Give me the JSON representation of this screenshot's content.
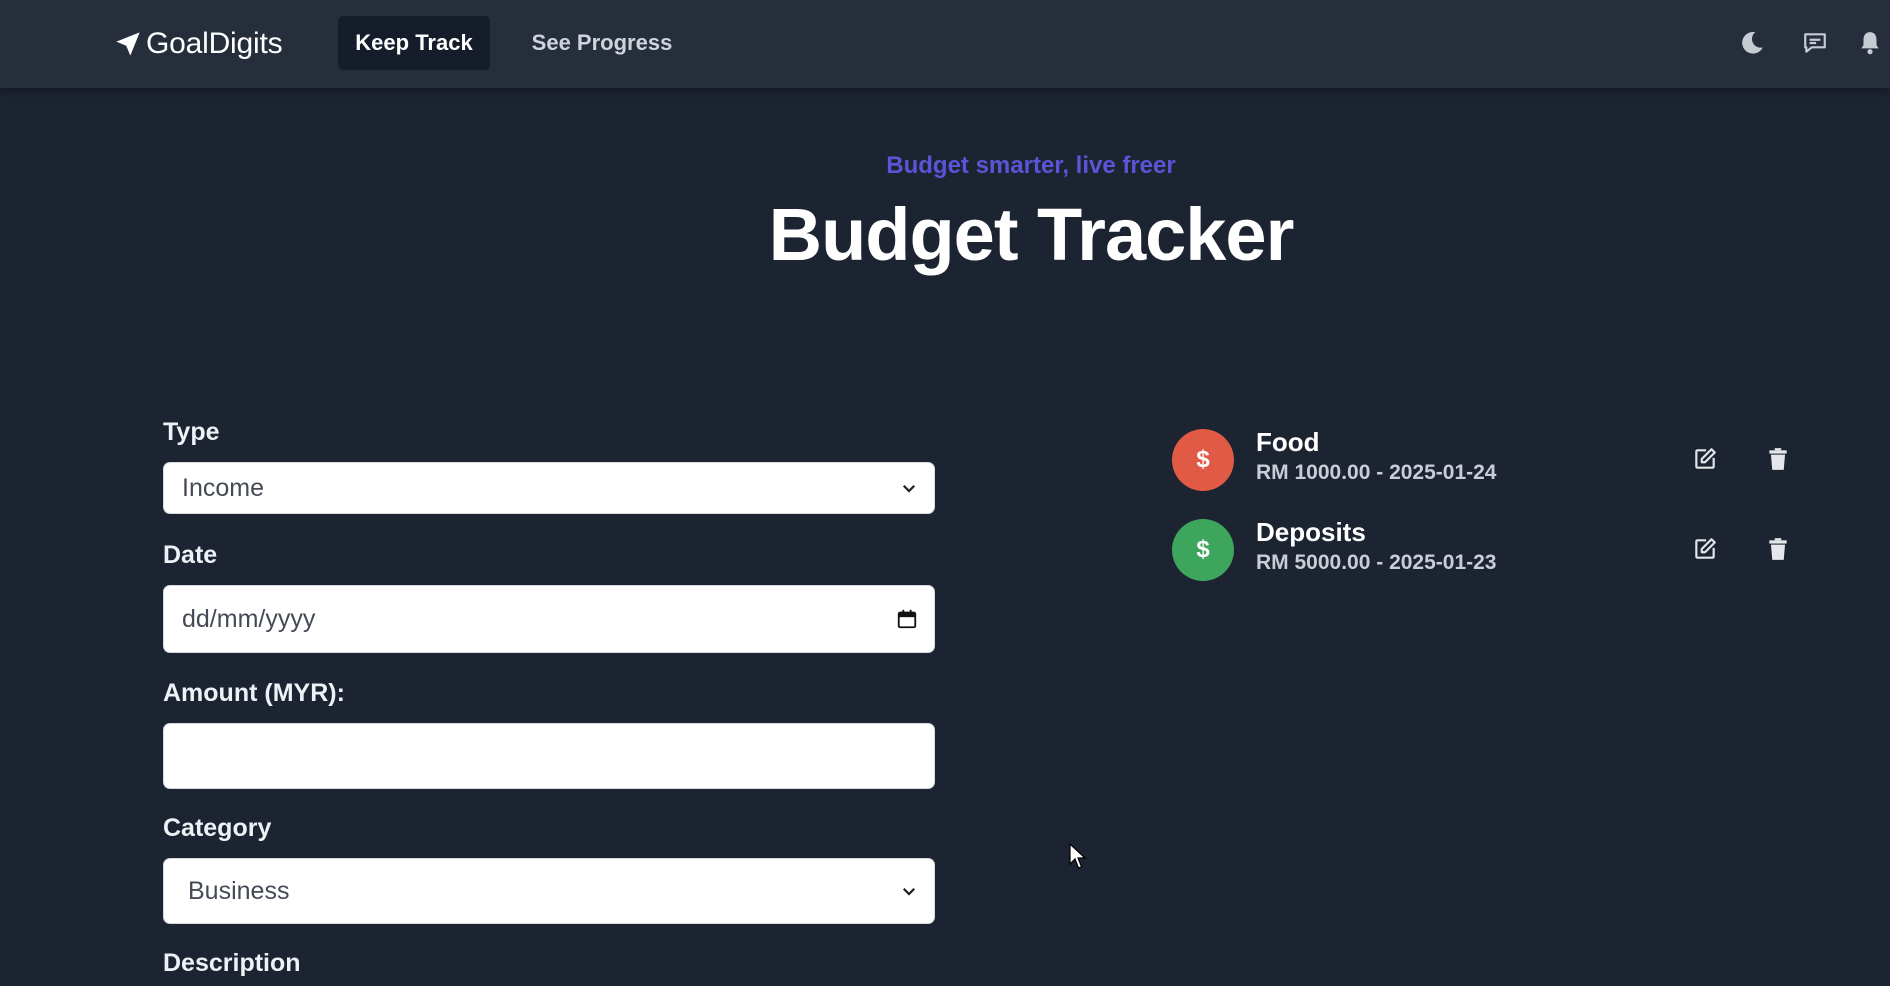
{
  "nav": {
    "brand": "GoalDigits",
    "links": [
      {
        "label": "Keep Track",
        "active": true
      },
      {
        "label": "See Progress",
        "active": false
      }
    ],
    "icons": [
      "moon-icon",
      "chat-icon",
      "bell-icon"
    ]
  },
  "header": {
    "tagline": "Budget smarter, live freer",
    "title": "Budget Tracker"
  },
  "form": {
    "type_label": "Type",
    "type_value": "Income",
    "date_label": "Date",
    "date_placeholder": "dd/mm/yyyy",
    "amount_label": "Amount (MYR):",
    "amount_value": "",
    "category_label": "Category",
    "category_value": "Business",
    "description_label": "Description"
  },
  "transactions": [
    {
      "symbol": "$",
      "name": "Food",
      "detail": "RM 1000.00 - 2025-01-24",
      "color": "#e15a45"
    },
    {
      "symbol": "$",
      "name": "Deposits",
      "detail": "RM 5000.00 - 2025-01-23",
      "color": "#3ea55d"
    }
  ],
  "colors": {
    "background": "#1c2331",
    "navbar": "#262e3c",
    "accent": "#5a55d6"
  }
}
